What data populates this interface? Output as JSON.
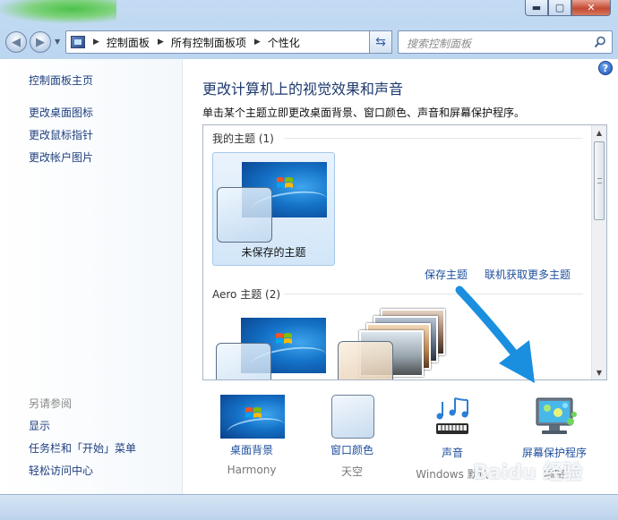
{
  "window": {
    "caption": {
      "minimize": "▬",
      "maximize": "▢",
      "close": "✕"
    }
  },
  "nav": {
    "breadcrumbs": [
      "控制面板",
      "所有控制面板项",
      "个性化"
    ],
    "search_placeholder": "搜索控制面板"
  },
  "sidebar": {
    "items": [
      {
        "label": "控制面板主页"
      },
      {
        "label": "更改桌面图标"
      },
      {
        "label": "更改鼠标指针"
      },
      {
        "label": "更改帐户图片"
      }
    ],
    "see_also_heading": "另请参阅",
    "see_also": [
      {
        "label": "显示"
      },
      {
        "label": "任务栏和「开始」菜单"
      },
      {
        "label": "轻松访问中心"
      }
    ]
  },
  "main": {
    "title": "更改计算机上的视觉效果和声音",
    "description": "单击某个主题立即更改桌面背景、窗口颜色、声音和屏幕保护程序。",
    "help_icon": "?",
    "themes": {
      "my_themes_heading": "我的主题 (1)",
      "unsaved_theme_label": "未保存的主题",
      "save_theme_link": "保存主题",
      "more_themes_link": "联机获取更多主题",
      "aero_heading": "Aero 主题 (2)"
    },
    "bottom": [
      {
        "label": "桌面背景",
        "value": "Harmony"
      },
      {
        "label": "窗口颜色",
        "value": "天空"
      },
      {
        "label": "声音",
        "value": "Windows 默认"
      },
      {
        "label": "屏幕保护程序",
        "value": "隔帘"
      }
    ]
  },
  "watermark": "Baidu 经验",
  "colors": {
    "link": "#1e3f7e",
    "title": "#1e3a6e",
    "annotation_arrow": "#1a8fe0"
  },
  "icons": [
    "back-arrow-icon",
    "forward-arrow-icon",
    "control-panel-icon",
    "refresh-icon",
    "search-icon",
    "help-icon",
    "windows-logo-icon",
    "music-notes-icon",
    "screensaver-monitor-icon"
  ]
}
